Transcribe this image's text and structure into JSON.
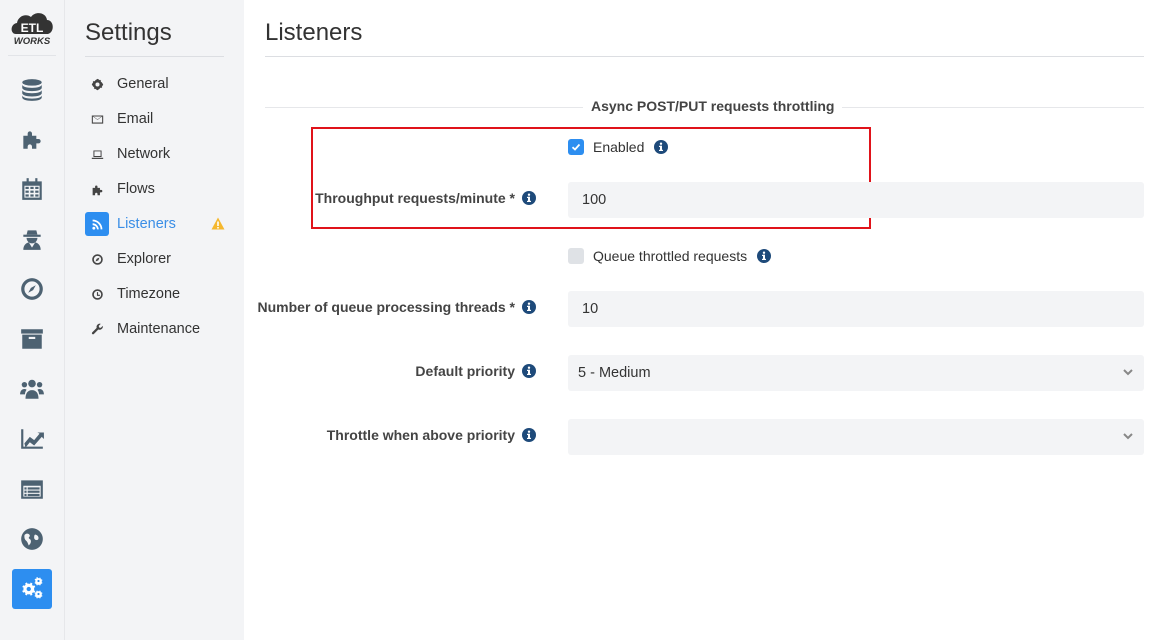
{
  "app": {
    "logo_text_top": "ETL",
    "logo_text_bottom": "WORKS"
  },
  "rail": {
    "items": [
      {
        "name": "connections",
        "icon": "database-icon"
      },
      {
        "name": "flows",
        "icon": "puzzle-icon"
      },
      {
        "name": "schedules",
        "icon": "calendar-icon"
      },
      {
        "name": "agents",
        "icon": "user-secret-icon"
      },
      {
        "name": "explorer",
        "icon": "compass-icon"
      },
      {
        "name": "archive",
        "icon": "archive-icon"
      },
      {
        "name": "users",
        "icon": "users-icon"
      },
      {
        "name": "statistics",
        "icon": "line-chart-icon"
      },
      {
        "name": "messages",
        "icon": "list-icon"
      },
      {
        "name": "web",
        "icon": "globe-icon"
      },
      {
        "name": "settings",
        "icon": "cogs-icon",
        "active": true
      }
    ]
  },
  "submenu": {
    "title": "Settings",
    "items": [
      {
        "label": "General",
        "icon": "gear-icon"
      },
      {
        "label": "Email",
        "icon": "envelope-icon"
      },
      {
        "label": "Network",
        "icon": "laptop-icon"
      },
      {
        "label": "Flows",
        "icon": "puzzle-icon"
      },
      {
        "label": "Listeners",
        "icon": "rss-icon",
        "active": true,
        "warning": true
      },
      {
        "label": "Explorer",
        "icon": "compass-icon"
      },
      {
        "label": "Timezone",
        "icon": "clock-icon"
      },
      {
        "label": "Maintenance",
        "icon": "wrench-icon"
      }
    ]
  },
  "main": {
    "title": "Listeners",
    "section_title": "Async POST/PUT requests throttling",
    "enabled": {
      "label": "Enabled",
      "checked": true
    },
    "throughput": {
      "label": "Throughput requests/minute *",
      "value": "100"
    },
    "queue_throttled": {
      "label": "Queue throttled requests",
      "checked": false
    },
    "queue_threads": {
      "label": "Number of queue processing threads *",
      "value": "10"
    },
    "default_priority": {
      "label": "Default priority",
      "value": "5 - Medium"
    },
    "throttle_above": {
      "label": "Throttle when above priority",
      "value": ""
    }
  },
  "colors": {
    "accent": "#2d8ef0",
    "highlight_border": "#e0131a",
    "warning": "#f5b82e",
    "info": "#1e4a7a"
  }
}
